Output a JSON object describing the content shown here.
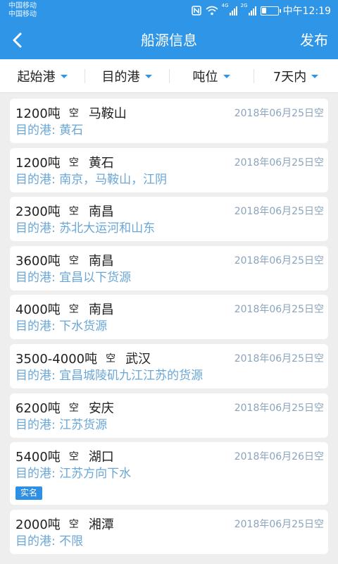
{
  "status_bar": {
    "carrier_1": "中国移动",
    "carrier_2": "中国移动",
    "net_1": "4G",
    "net_2": "2G",
    "time": "中午12:19"
  },
  "nav": {
    "title": "船源信息",
    "publish_label": "发布",
    "back_icon": "chevron-left-icon"
  },
  "filters": [
    {
      "label": "起始港"
    },
    {
      "label": "目的港"
    },
    {
      "label": "吨位"
    },
    {
      "label": "7天内"
    }
  ],
  "colors": {
    "primary": "#2f95e6",
    "destination_text": "#6aa6d6",
    "date_text": "#8aa4bd"
  },
  "listings": [
    {
      "tonnage": "1200吨",
      "empty": "空",
      "port": "马鞍山",
      "date": "2018年06月25日空",
      "destination": "目的港: 黄石"
    },
    {
      "tonnage": "1200吨",
      "empty": "空",
      "port": "黄石",
      "date": "2018年06月25日空",
      "destination": "目的港: 南京，马鞍山，江阴"
    },
    {
      "tonnage": "2300吨",
      "empty": "空",
      "port": "南昌",
      "date": "2018年06月25日空",
      "destination": "目的港: 苏北大运河和山东"
    },
    {
      "tonnage": "3600吨",
      "empty": "空",
      "port": "南昌",
      "date": "2018年06月25日空",
      "destination": "目的港: 宜昌以下货源"
    },
    {
      "tonnage": "4000吨",
      "empty": "空",
      "port": "南昌",
      "date": "2018年06月25日空",
      "destination": "目的港: 下水货源"
    },
    {
      "tonnage": "3500-4000吨",
      "empty": "空",
      "port": "武汉",
      "date": "2018年06月25日空",
      "destination": "目的港: 宜昌城陵矶九江江苏的货源"
    },
    {
      "tonnage": "6200吨",
      "empty": "空",
      "port": "安庆",
      "date": "2018年06月25日空",
      "destination": "目的港: 江苏货源"
    },
    {
      "tonnage": "5400吨",
      "empty": "空",
      "port": "湖口",
      "date": "2018年06月26日空",
      "destination": "目的港: 江苏方向下水",
      "badge": "实名"
    },
    {
      "tonnage": "2000吨",
      "empty": "空",
      "port": "湘潭",
      "date": "2018年06月25日空",
      "destination": "目的港: 不限"
    }
  ]
}
